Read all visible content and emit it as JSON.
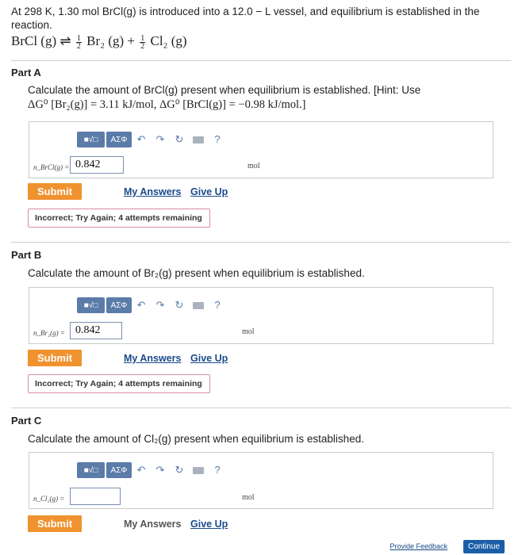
{
  "intro": {
    "line": "At 298 K, 1.30 mol BrCl(g) is introduced into a 12.0 − L vessel, and equilibrium is established in the reaction."
  },
  "reaction": {
    "left": "BrCl (g)",
    "arrow": "⇌",
    "half_num": "1",
    "half_den": "2",
    "br2": "Br₂ (g)",
    "plus": "+",
    "cl2": "Cl₂ (g)"
  },
  "toolbar": {
    "sqrt_label": "■√□",
    "greek_label": "ΑΣΦ",
    "undo_icon": "↶",
    "redo_icon": "↷",
    "reset_icon": "↻",
    "help_label": "?"
  },
  "parts": [
    {
      "title": "Part A",
      "question": "Calculate the amount of BrCl(g) present when equilibrium is established. [Hint: Use",
      "hint": "ΔG⁰ [Br₂(g)] = 3.11 kJ/mol, ΔG⁰ [BrCl(g)] = −0.98 kJ/mol.]",
      "var_label": "n_BrCl(g) =",
      "input_value": "0.842",
      "unit": "mol",
      "submit_label": "Submit",
      "my_answers_label": "My Answers",
      "give_up_label": "Give Up",
      "feedback": "Incorrect; Try Again; 4 attempts remaining"
    },
    {
      "title": "Part B",
      "question": "Calculate the amount of Br₂(g) present when equilibrium is established.",
      "var_label": "n_Br₂(g) =",
      "input_value": "0.842",
      "unit": "mol",
      "submit_label": "Submit",
      "my_answers_label": "My Answers",
      "give_up_label": "Give Up",
      "feedback": "Incorrect; Try Again; 4 attempts remaining"
    },
    {
      "title": "Part C",
      "question": "Calculate the amount of Cl₂(g) present when equilibrium is established.",
      "var_label": "n_Cl₂(g) =",
      "input_value": "",
      "unit": "mol",
      "submit_label": "Submit",
      "my_answers_label": "My Answers",
      "give_up_label": "Give Up"
    }
  ],
  "footer": {
    "provide_feedback": "Provide Feedback",
    "continue": "Continue"
  },
  "colors": {
    "submit": "#f0922f",
    "link": "#1a4a8a",
    "toolbar": "#5b7ba8",
    "feedback_border": "#d98ab0",
    "continue": "#1b5ea8"
  }
}
